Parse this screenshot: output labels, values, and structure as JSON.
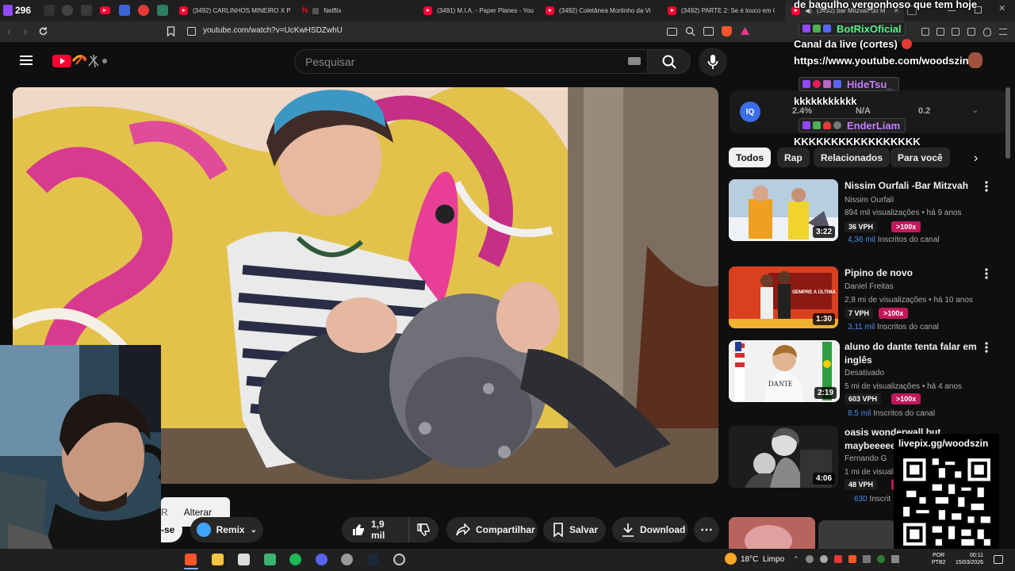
{
  "browser": {
    "tab_counter": "296",
    "tabs": [
      {
        "label": "(3492) CARLINHOS MINEIRO X PA"
      },
      {
        "label": "Netflix"
      },
      {
        "label": "(3491) M.I.A. - Paper Planes - You"
      },
      {
        "label": "(3492) Coletânea Mortinho da Vi"
      },
      {
        "label": "(3492) PARTE 2: Se é louco em Co"
      },
      {
        "label": "(3492) bar Mitzvah do M"
      }
    ],
    "url": "youtube.com/watch?v=UcKwHSDZwhU"
  },
  "youtube": {
    "search_placeholder": "Pesquisar",
    "actions": {
      "remix": "Remix",
      "likes": "1,9 mil",
      "share": "Compartilhar",
      "save": "Salvar",
      "download": "Download"
    },
    "partial_left": {
      "alterar": "Alterar",
      "r": "R",
      "se": "-se"
    },
    "iq": {
      "logo": "IQ",
      "values": [
        "2.4%",
        "N/A",
        "0.2"
      ]
    },
    "chips": [
      "Todos",
      "Rap",
      "Relacionados",
      "Para você"
    ],
    "recommendations": [
      {
        "title": "Nissim Ourfali -Bar Mitzvah",
        "channel": "Nissim Ourfali",
        "meta": "894 mil visualizações • há 9 anos",
        "duration": "3:22",
        "vph": "36 VPH",
        "vph_tag": ">100x",
        "subs_value": "4,36 mil",
        "subs_label": "Inscritos do canal"
      },
      {
        "title": "Pipino de novo",
        "channel": "Daniel Freitas",
        "meta": "2,8 mi de visualizações • há 10 anos",
        "duration": "1:30",
        "vph": "7 VPH",
        "vph_tag": ">100x",
        "subs_value": "3,11 mil",
        "subs_label": "Inscritos do canal",
        "thumb_text": "SEMPRE A ÚLTIMA"
      },
      {
        "title": "aluno do dante tenta falar em inglês",
        "channel": "Desativado",
        "meta": "5 mi de visualizações • há 4 anos",
        "duration": "2:19",
        "vph": "603 VPH",
        "vph_tag": ">100x",
        "subs_value": "8,5 mil",
        "subs_label": "Inscritos do canal",
        "thumb_text": "DANTE"
      },
      {
        "title": "oasis wonderwall but maybeeeee",
        "channel": "Fernando G",
        "meta": "1 mi de visualiz",
        "duration": "4:06",
        "vph": "48 VPH",
        "vph_tag": ">",
        "subs_value": "630",
        "subs_label": "Inscrit"
      }
    ]
  },
  "overlay": {
    "chat": [
      {
        "user": "",
        "message": "de bagulho vergonhoso que tem hoje"
      },
      {
        "user": "BotRixOficial",
        "message": "Canal da live (cortes)"
      },
      {
        "user": "",
        "message": "https://www.youtube.com/woodszin"
      },
      {
        "user": "HideTsu_",
        "message": "kkkkkkkkkkk"
      },
      {
        "user": "EnderLiam",
        "message": "KKKKKKKKKKKKKKKKK"
      }
    ],
    "livepix_label": "livepix.gg/woodszin"
  },
  "taskbar": {
    "weather": "18°C  Limpo",
    "lang_top": "POR",
    "lang_bottom": "PTB2",
    "time": "00:11",
    "date": "15/03/2026"
  },
  "colors": {
    "youtube_red": "#ff0033",
    "vph_tag": "#c2185b",
    "subs_blue": "#4a8ff5",
    "bot_green": "#57f287",
    "user_purple": "#c77dff"
  }
}
